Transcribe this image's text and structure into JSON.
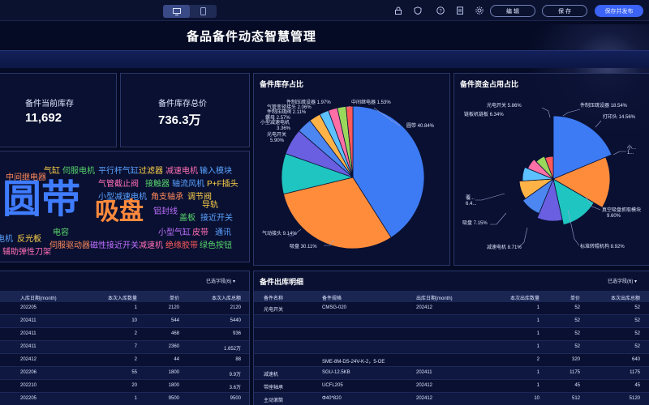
{
  "toolbar": {
    "edit_label": "编 辑",
    "save_label": "保 存",
    "publish_label": "保存并发布"
  },
  "header": {
    "title": "备品备件动态智慧管理"
  },
  "kpis": [
    {
      "label": "备件当前库存",
      "value": "11,692"
    },
    {
      "label": "备件库存总价",
      "value": "736.3万"
    }
  ],
  "word_cloud": [
    {
      "text": "中间继电器",
      "color": "#ff8a5c",
      "size": 10
    },
    {
      "text": "气缸",
      "color": "#ffd24a",
      "size": 10
    },
    {
      "text": "伺服电机",
      "color": "#57d36c",
      "size": 10
    },
    {
      "text": "平行杆气缸",
      "color": "#5aa2ff",
      "size": 10
    },
    {
      "text": "过滤器",
      "color": "#ffd24a",
      "size": 10
    },
    {
      "text": "减速电机",
      "color": "#ff6fb5",
      "size": 10
    },
    {
      "text": "输入模块",
      "color": "#5aa2ff",
      "size": 10
    },
    {
      "text": "圆带",
      "color": "#3f7cff",
      "size": 48
    },
    {
      "text": "吸盘",
      "color": "#ff8a3d",
      "size": 30
    },
    {
      "text": "气管截止阀",
      "color": "#ff6fb5",
      "size": 10
    },
    {
      "text": "接触器",
      "color": "#57d36c",
      "size": 10
    },
    {
      "text": "轴流风机",
      "color": "#5aa2ff",
      "size": 10
    },
    {
      "text": "P+F插头",
      "color": "#ffd24a",
      "size": 10
    },
    {
      "text": "小型减速电机",
      "color": "#5aa2ff",
      "size": 10
    },
    {
      "text": "角支轴承",
      "color": "#ff8a5c",
      "size": 10
    },
    {
      "text": "调节阀",
      "color": "#ffd24a",
      "size": 10
    },
    {
      "text": "铝封线",
      "color": "#c070ff",
      "size": 10
    },
    {
      "text": "导轨",
      "color": "#ffd24a",
      "size": 10
    },
    {
      "text": "盖板",
      "color": "#57d36c",
      "size": 10
    },
    {
      "text": "接近开关",
      "color": "#5aa2ff",
      "size": 10
    },
    {
      "text": "电容",
      "color": "#57d36c",
      "size": 10
    },
    {
      "text": "小型气缸",
      "color": "#c070ff",
      "size": 10
    },
    {
      "text": "皮带",
      "color": "#ff6fb5",
      "size": 10
    },
    {
      "text": "通讯",
      "color": "#5aa2ff",
      "size": 10
    },
    {
      "text": "电机",
      "color": "#5aa2ff",
      "size": 10
    },
    {
      "text": "反光板",
      "color": "#ffd24a",
      "size": 10
    },
    {
      "text": "伺服驱动器",
      "color": "#ff8a5c",
      "size": 10
    },
    {
      "text": "磁性接近开关",
      "color": "#c070ff",
      "size": 10
    },
    {
      "text": "减速机",
      "color": "#ff6fb5",
      "size": 10
    },
    {
      "text": "绝缘胶带",
      "color": "#ff5c5c",
      "size": 10
    },
    {
      "text": "绿色按钮",
      "color": "#57d36c",
      "size": 10
    },
    {
      "text": "辅助弹性刀架",
      "color": "#ff6fb5",
      "size": 10
    }
  ],
  "inbound_table": {
    "filter_label": "已选字段(6)",
    "columns": [
      "入库日期(month)",
      "本次入库数量",
      "单价",
      "本次入库总额"
    ],
    "rows": [
      [
        "202205",
        "1",
        "2120",
        "2120"
      ],
      [
        "202411",
        "10",
        "544",
        "5440"
      ],
      [
        "202411",
        "2",
        "468",
        "936"
      ],
      [
        "202411",
        "7",
        "2360",
        "1.652万"
      ],
      [
        "202412",
        "2",
        "44",
        "88"
      ],
      [
        "202206",
        "55",
        "1800",
        "9.9万"
      ],
      [
        "202210",
        "20",
        "1800",
        "3.6万"
      ],
      [
        "202205",
        "1",
        "9500",
        "9500"
      ]
    ]
  },
  "outbound_table": {
    "title": "备件出库明细",
    "filter_label": "已选字段(6)",
    "columns": [
      "备件名称",
      "备件规格",
      "出库日期(month)",
      "本次出库数量",
      "单价",
      "本次出库总额"
    ],
    "rows": [
      [
        "光电开关",
        "CMSG-020",
        "202412",
        "1",
        "52",
        "52"
      ],
      [
        "",
        "",
        "",
        "1",
        "52",
        "52"
      ],
      [
        "",
        "",
        "",
        "1",
        "52",
        "52"
      ],
      [
        "",
        "",
        "",
        "1",
        "52",
        "52"
      ],
      [
        "",
        "SME-8M-DS-24V-K-2，5-OE",
        "",
        "2",
        "320",
        "640"
      ],
      [
        "减速机",
        "SGU-12.5KB",
        "202411",
        "1",
        "1175",
        "1175"
      ],
      [
        "带座轴承",
        "UCFL205",
        "202412",
        "1",
        "45",
        "45"
      ],
      [
        "主动滚筒",
        "Φ40*820",
        "202412",
        "10",
        "512",
        "5120"
      ]
    ]
  },
  "chart_data": [
    {
      "type": "pie",
      "title": "备件库存占比",
      "slices": [
        {
          "label": "圆带",
          "value": 40.84,
          "color": "#3d7bf5"
        },
        {
          "label": "吸盘",
          "value": 30.11,
          "color": "#ff8c3b"
        },
        {
          "label": "气动接头",
          "value": 9.14,
          "color": "#1fc5c0"
        },
        {
          "label": "中间继电器",
          "value": 5.9,
          "color": "#6a5fe0"
        },
        {
          "label": "小型减速电机",
          "value": 3.36,
          "color": "#4c86f0"
        },
        {
          "label": "螺母",
          "value": 2.57,
          "color": "#ffb347"
        },
        {
          "label": "件制压疏阀",
          "value": 2.11,
          "color": "#5dc1ff"
        },
        {
          "label": "气管变径接头",
          "value": 2.06,
          "color": "#ff6fa5"
        },
        {
          "label": "件制压缩设器",
          "value": 1.97,
          "color": "#9ad85c"
        },
        {
          "label": "中间继电器",
          "value": 1.53,
          "color": "#ff5a5a"
        }
      ],
      "label_texts": {
        "right_top": "中间继电器 1.53%",
        "top_1": "件制压疏设器 1.97%",
        "top_2": "气管变径接头 2.06%",
        "top_3": "件制压疏阀 2.11%",
        "left_1": "螺母 2.57%",
        "left_2": "小型减速电机",
        "left_2b": "3.36%",
        "left_3": "光电开关",
        "left_3b": "5.90%",
        "left_4": "气动接头 9.14%",
        "bottom": "吸盘 30.11%",
        "right": "圆带 40.84%"
      }
    },
    {
      "type": "pie",
      "title": "备件资金占用占比",
      "slices": [
        {
          "label": "件制压疏设器",
          "value": 18.54,
          "color": "#3d7bf5"
        },
        {
          "label": "打印头",
          "value": 14.56,
          "color": "#ff8c3b"
        },
        {
          "label": "小...",
          "value": 13.0,
          "color": "#1fc5c0"
        },
        {
          "label": "真空吸盘抓取模块",
          "value": 9.6,
          "color": "#6a5fe0"
        },
        {
          "label": "标准转辊机构",
          "value": 8.92,
          "color": "#4c86f0"
        },
        {
          "label": "减速电机",
          "value": 8.71,
          "color": "#ffb347"
        },
        {
          "label": "吸盘",
          "value": 7.15,
          "color": "#5dc1ff"
        },
        {
          "label": "覆...",
          "value": 6.4,
          "color": "#ff6fa5"
        },
        {
          "label": "链板机链板",
          "value": 6.34,
          "color": "#9ad85c"
        },
        {
          "label": "光电开关",
          "value": 5.86,
          "color": "#ff5a5a"
        }
      ],
      "label_texts": {
        "l1": "光电开关 5.86%",
        "l2": "链板机链板 6.34%",
        "r1": "件制压疏设器 18.54%",
        "r2": "打印头 14.56%",
        "r3a": "小...",
        "r3b": "1...",
        "l3a": "覆...",
        "l3b": "6.4...",
        "l4": "吸盘 7.15%",
        "l5": "减速电机 8.71%",
        "r4a": "真空吸盘抓取模块",
        "r4b": "9.60%",
        "r5": "标准转辊机构 8.92%"
      }
    }
  ]
}
